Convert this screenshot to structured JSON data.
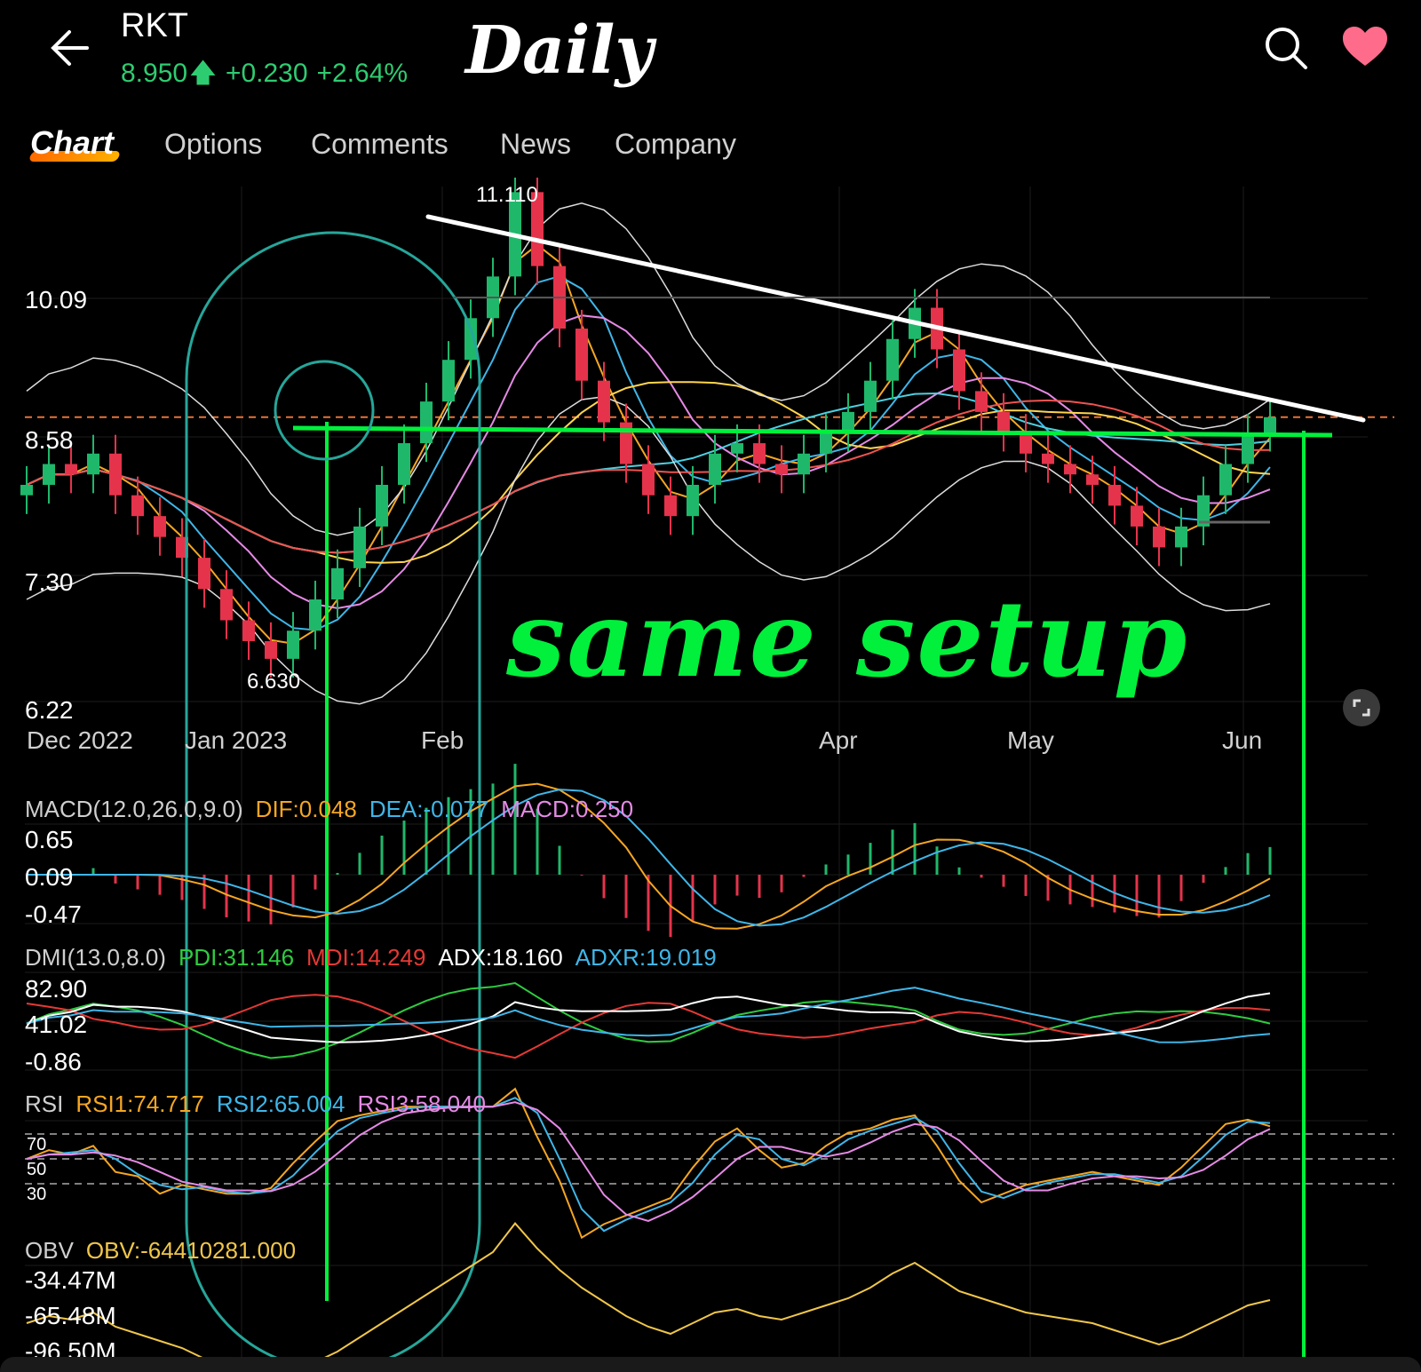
{
  "header": {
    "ticker": "RKT",
    "price": "8.950",
    "change": "+0.230",
    "change_pct": "+2.64%",
    "annotation_title": "Daily",
    "icons": {
      "back": "arrow-left-icon",
      "search": "search-icon",
      "favorite": "heart-icon"
    },
    "colors": {
      "up": "#2ecc71",
      "favorite": "#ff6b8a"
    }
  },
  "tabs": [
    {
      "label": "Chart",
      "active": true
    },
    {
      "label": "Options",
      "active": false
    },
    {
      "label": "Comments",
      "active": false
    },
    {
      "label": "News",
      "active": false
    },
    {
      "label": "Company",
      "active": false
    }
  ],
  "price_chart": {
    "y_labels": [
      "10.09",
      "8.58",
      "7.30",
      "6.22"
    ],
    "x_labels": [
      "Dec 2022",
      "Jan 2023",
      "Feb",
      "Apr",
      "May",
      "Jun"
    ],
    "high_label": "11.110",
    "low_label": "6.630",
    "reference_price": "8.950"
  },
  "chart_data": {
    "type": "candlestick",
    "x_labels": [
      "Dec 2022",
      "Jan 2023",
      "Feb",
      "Apr",
      "May",
      "Jun"
    ],
    "y_ticks": [
      10.09,
      8.58,
      7.3,
      6.22
    ],
    "ylim": [
      6.22,
      11.3
    ],
    "period_high": 11.11,
    "period_low": 6.63,
    "last_close": 8.95,
    "close_approx": [
      8.3,
      8.5,
      8.4,
      8.6,
      8.2,
      8.0,
      7.8,
      7.6,
      7.3,
      7.0,
      6.8,
      6.63,
      6.9,
      7.2,
      7.5,
      7.9,
      8.3,
      8.7,
      9.1,
      9.5,
      9.9,
      10.3,
      11.11,
      10.4,
      9.8,
      9.3,
      8.9,
      8.5,
      8.2,
      8.0,
      8.3,
      8.6,
      8.7,
      8.5,
      8.4,
      8.6,
      8.8,
      9.0,
      9.3,
      9.7,
      10.0,
      9.6,
      9.2,
      9.0,
      8.8,
      8.6,
      8.5,
      8.4,
      8.3,
      8.1,
      7.9,
      7.7,
      7.9,
      8.2,
      8.5,
      8.8,
      8.95
    ],
    "annotations": {
      "overlay_text": "same setup",
      "title": "Daily"
    }
  },
  "indicators": {
    "macd": {
      "name": "MACD(12.0,26.0,9.0)",
      "dif": "DIF:0.048",
      "dea": "DEA:-0.077",
      "macd": "MACD:0.250",
      "y_labels": [
        "0.65",
        "0.09",
        "-0.47"
      ]
    },
    "dmi": {
      "name": "DMI(13.0,8.0)",
      "pdi": "PDI:31.146",
      "mdi": "MDI:14.249",
      "adx": "ADX:18.160",
      "adxr": "ADXR:19.019",
      "y_labels": [
        "82.90",
        "41.02",
        "-0.86"
      ]
    },
    "rsi": {
      "name": "RSI",
      "rsi1": "RSI1:74.717",
      "rsi2": "RSI2:65.004",
      "rsi3": "RSI3:58.040",
      "y_labels": [
        "70",
        "50",
        "30"
      ]
    },
    "obv": {
      "name": "OBV",
      "obv": "OBV:-64410281.000",
      "y_labels": [
        "-34.47M",
        "-65.48M",
        "-96.50M"
      ]
    }
  },
  "colors": {
    "up": "#1fb86b",
    "down": "#e5334b",
    "dif": "#f5a623",
    "dea": "#3fb6e8",
    "macd": "#e68ae6",
    "pdi": "#2ecc40",
    "mdi": "#e53935",
    "adx": "#ffffff",
    "adxr": "#3fb6e8",
    "obv": "#f0c64a",
    "annotation": "#00f03c",
    "circle": "#26a69a"
  }
}
